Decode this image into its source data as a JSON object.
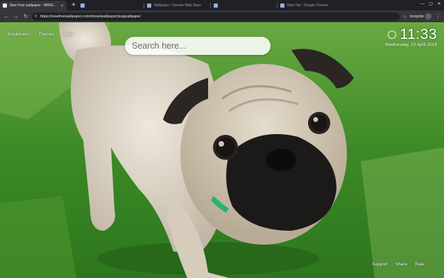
{
  "browser": {
    "tabs": [
      {
        "label": "New Free wallpaper - 08042019",
        "active": true
      },
      {
        "label": "",
        "active": false
      },
      {
        "label": "Wallpaper: Chrome Web Store",
        "active": false
      },
      {
        "label": "",
        "active": false
      },
      {
        "label": "New Tab - Google Chrome",
        "active": false
      }
    ],
    "new_tab_symbol": "+",
    "url": "https://newfreewallpaper.com/show/wallpaper/pugwallpaper",
    "incognito_label": "Incognito",
    "window_controls": [
      "—",
      "▢",
      "✕"
    ]
  },
  "page": {
    "top_links": [
      "Bookmarks",
      "Themes",
      "Apps"
    ],
    "search_placeholder": "Search here...",
    "time": "11:33",
    "date": "Wednesday, 10 April 2019",
    "bottom_links": [
      "Support",
      "Share",
      "Rate"
    ]
  },
  "icons": {
    "back": "back-arrow-icon",
    "forward": "forward-arrow-icon",
    "reload": "reload-icon",
    "lock": "lock-icon",
    "star": "star-icon",
    "incognito": "incognito-icon",
    "weather": "weather-icon"
  },
  "colors": {
    "chrome_dark": "#202124",
    "chrome_toolbar": "#35363a",
    "grass": "#3f8d2a",
    "pug_fawn": "#dcd3c4",
    "pug_mask": "#1c1a19",
    "collar": "#27b36b"
  }
}
